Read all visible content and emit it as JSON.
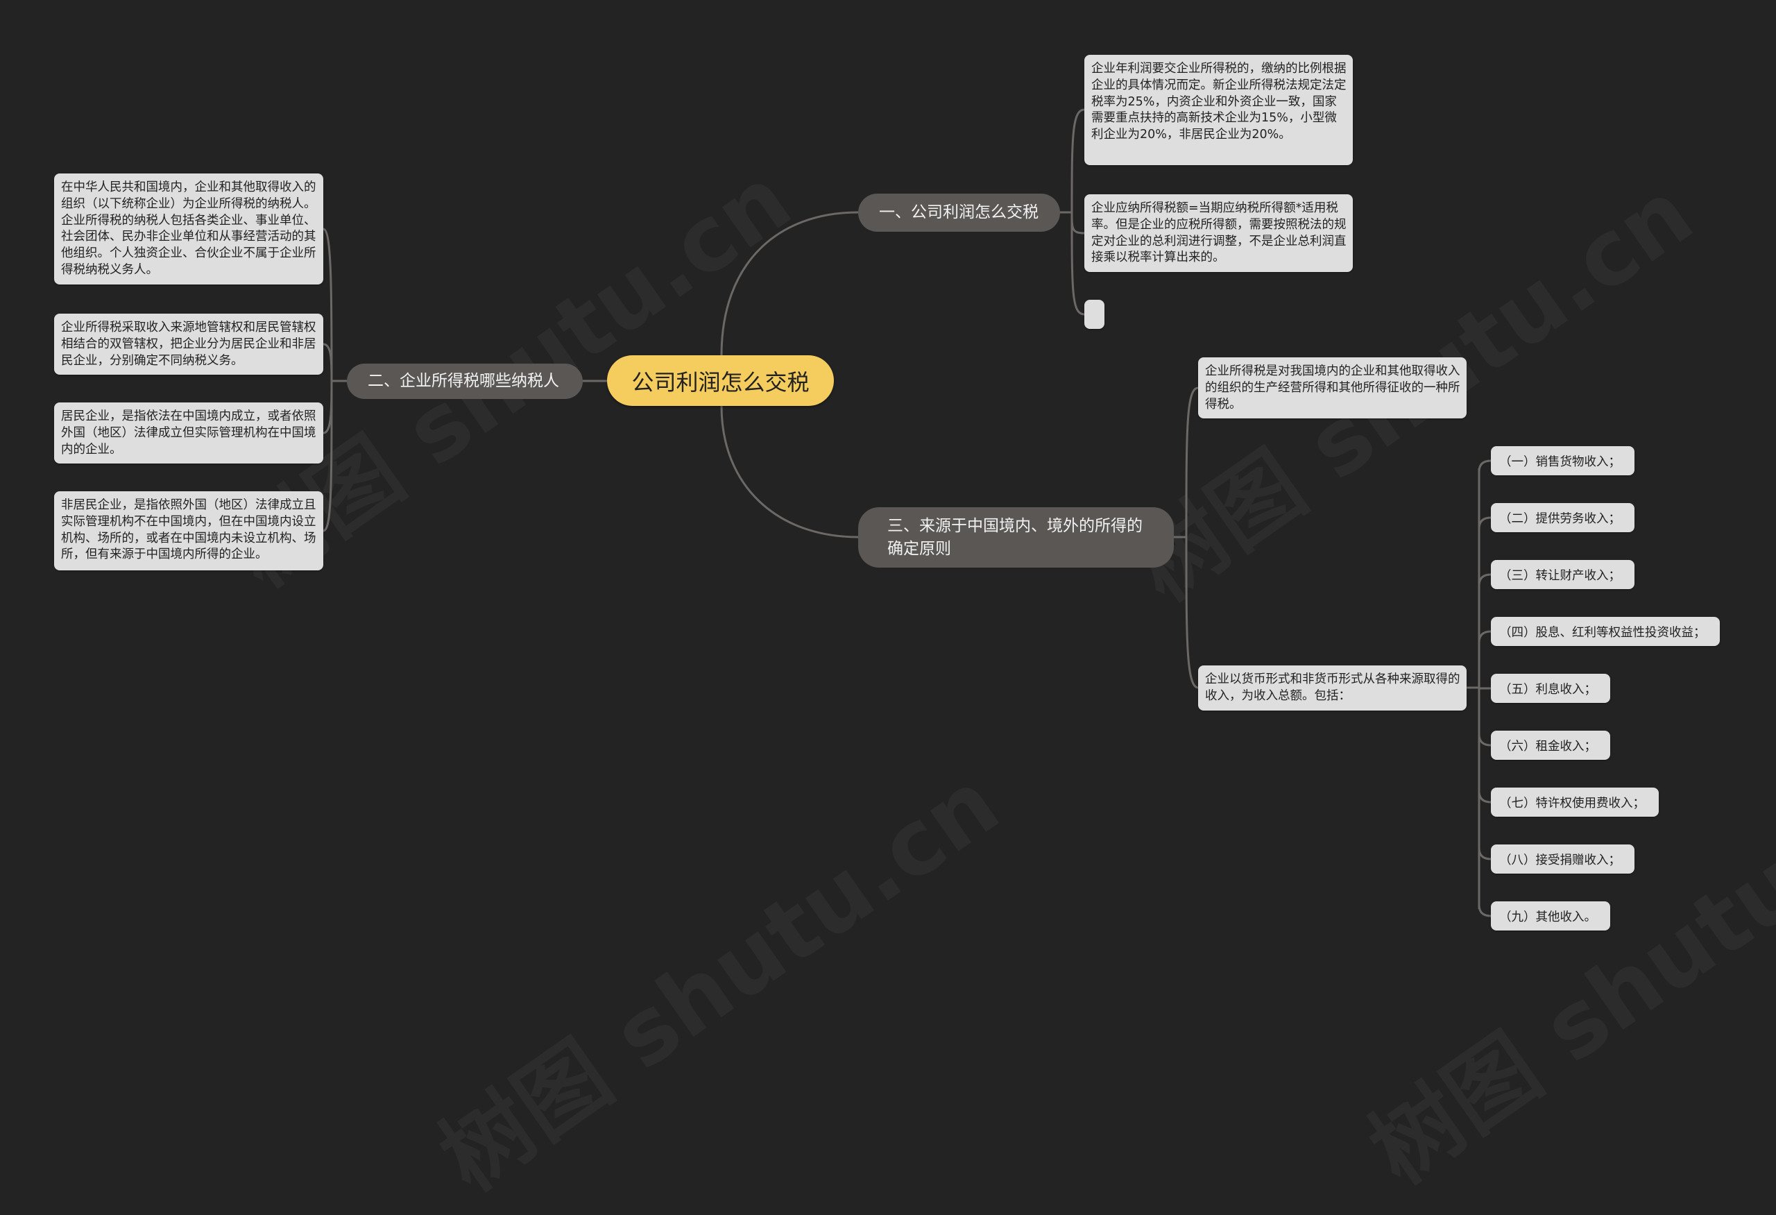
{
  "root": {
    "label": "公司利润怎么交税"
  },
  "branches": {
    "b1": {
      "label": "一、公司利润怎么交税",
      "children": [
        "企业年利润要交企业所得税的，缴纳的比例根据企业的具体情况而定。新企业所得税法规定法定税率为25%，内资企业和外资企业一致，国家需要重点扶持的高新技术企业为15%，小型微利企业为20%，非居民企业为20%。",
        "企业应纳所得税额=当期应纳税所得额*适用税率。但是企业的应税所得额，需要按照税法的规定对企业的总利润进行调整，不是企业总利润直接乘以税率计算出来的。",
        ""
      ]
    },
    "b2": {
      "label": "二、企业所得税哪些纳税人",
      "children": [
        "在中华人民共和国境内，企业和其他取得收入的组织（以下统称企业）为企业所得税的纳税人。企业所得税的纳税人包括各类企业、事业单位、社会团体、民办非企业单位和从事经营活动的其他组织。个人独资企业、合伙企业不属于企业所得税纳税义务人。",
        "企业所得税采取收入来源地管辖权和居民管辖权相结合的双管辖权，把企业分为居民企业和非居民企业，分别确定不同纳税义务。",
        "居民企业，是指依法在中国境内成立，或者依照外国（地区）法律成立但实际管理机构在中国境内的企业。",
        "非居民企业，是指依照外国（地区）法律成立且实际管理机构不在中国境内，但在中国境内设立机构、场所的，或者在中国境内未设立机构、场所，但有来源于中国境内所得的企业。"
      ]
    },
    "b3": {
      "label": "三、来源于中国境内、境外的所得的确定原则",
      "children": [
        "企业所得税是对我国境内的企业和其他取得收入的组织的生产经营所得和其他所得征收的一种所得税。",
        "企业以货币形式和非货币形式从各种来源取得的收入，为收入总额。包括："
      ],
      "income_items": [
        "（一）销售货物收入；",
        "（二）提供劳务收入；",
        "（三）转让财产收入；",
        "（四）股息、红利等权益性投资收益；",
        "（五）利息收入；",
        "（六）租金收入；",
        "（七）特许权使用费收入；",
        "（八）接受捐赠收入；",
        "（九）其他收入。"
      ]
    }
  },
  "watermark": "树图 shutu.cn",
  "colors": {
    "background": "#232323",
    "root": "#f5cc5e",
    "branch": "#5a5755",
    "leaf": "#dedede",
    "connector": "#6b6866"
  }
}
